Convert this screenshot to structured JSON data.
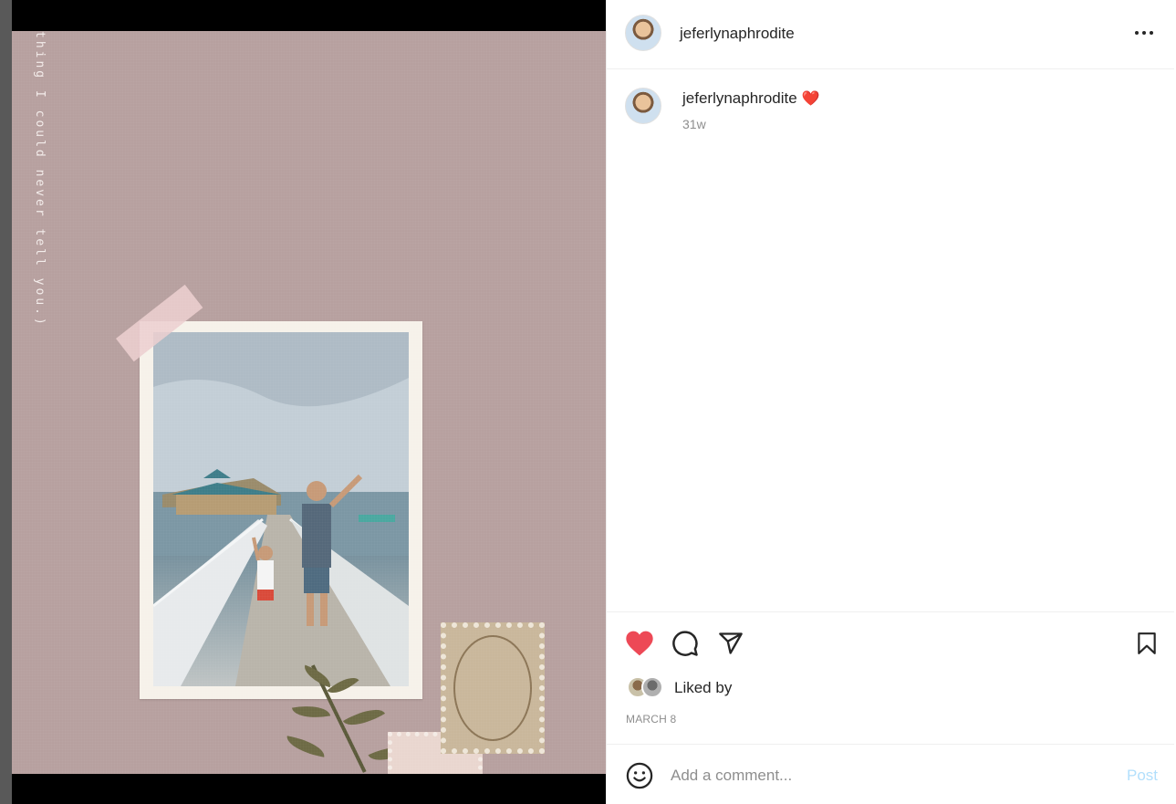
{
  "post": {
    "vertical_text": "thing I could never tell you.)"
  },
  "header": {
    "username": "jeferlynaphrodite",
    "more_icon": "more-horizontal-icon"
  },
  "caption": {
    "username": "jeferlynaphrodite",
    "emoji": "❤️",
    "time": "31w"
  },
  "actions": {
    "like_icon": "heart-filled-icon",
    "comment_icon": "comment-icon",
    "share_icon": "send-icon",
    "save_icon": "bookmark-icon",
    "like_color": "#ed4956"
  },
  "likes": {
    "label": "Liked by"
  },
  "date": "MARCH 8",
  "comment": {
    "placeholder": "Add a comment...",
    "post_label": "Post",
    "emoji_icon": "smiley-icon"
  }
}
